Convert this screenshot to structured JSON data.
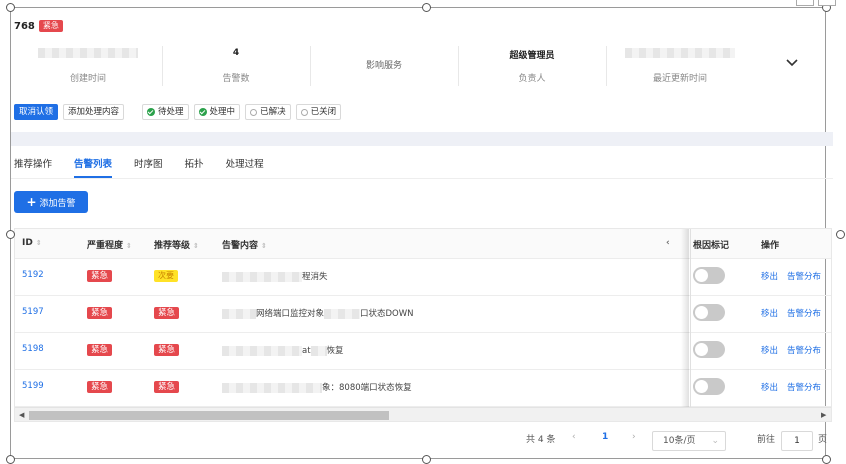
{
  "header": {
    "id": "768",
    "severity_badge": "紧急"
  },
  "stats": [
    {
      "value": "",
      "label": "创建时间"
    },
    {
      "value": "4",
      "label": "告警数"
    },
    {
      "value": "",
      "label": "影响服务"
    },
    {
      "value": "超级管理员",
      "label": "负责人"
    },
    {
      "value": "",
      "label": "最近更新时间"
    }
  ],
  "actions": {
    "cancel_ack": "取消认领",
    "add_handling": "添加处理内容",
    "statuses": [
      "待处理",
      "处理中",
      "已解决",
      "已关闭"
    ]
  },
  "tabs": [
    "推荐操作",
    "告警列表",
    "时序图",
    "拓扑",
    "处理过程"
  ],
  "add_alert_label": "添加告警",
  "table": {
    "headers": {
      "id": "ID",
      "severity": "严重程度",
      "recommend": "推荐等级",
      "content": "告警内容",
      "root": "根因标记",
      "ops": "操作"
    },
    "rows": [
      {
        "id": "5192",
        "severity": "紧急",
        "recommend": "次要",
        "content_visible": "程消失"
      },
      {
        "id": "5197",
        "severity": "紧急",
        "recommend": "紧急",
        "content_visible": "网络端口监控对象",
        "content_visible2": "口状态DOWN"
      },
      {
        "id": "5198",
        "severity": "紧急",
        "recommend": "紧急",
        "content_visible": "at",
        "content_visible2": "恢复"
      },
      {
        "id": "5199",
        "severity": "紧急",
        "recommend": "紧急",
        "content_visible": "象：8080端口状态恢复"
      }
    ],
    "op_remove": "移出",
    "op_dist": "告警分布"
  },
  "pagination": {
    "total": "共 4 条",
    "current": "1",
    "page_size": "10条/页",
    "goto_label": "前往",
    "goto_value": "1",
    "page_unit": "页"
  },
  "colors": {
    "primary": "#1f6fe5",
    "danger": "#e5484d",
    "warning": "#ffe227",
    "success": "#2ba14b"
  }
}
